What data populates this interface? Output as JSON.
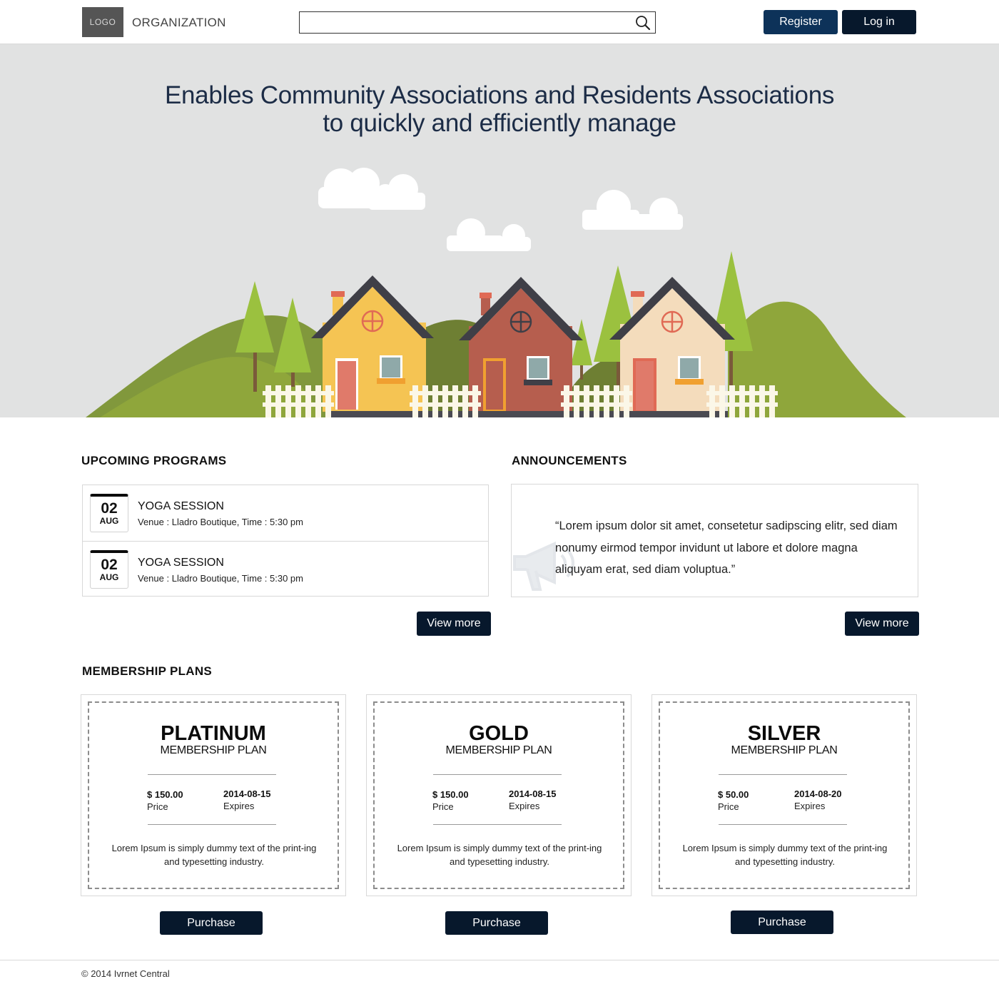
{
  "header": {
    "logo": "LOGO",
    "organization": "ORGANIZATION",
    "search_placeholder": "",
    "register": "Register",
    "login": "Log in"
  },
  "hero": {
    "line1": "Enables Community Associations and Residents Associations",
    "line2": "to quickly and efficiently manage",
    "colors": {
      "background": "#e1e2e2",
      "hill": "#8fa63b",
      "tree": "#9bc13f",
      "house_yellow": "#f5c453",
      "house_brown": "#b65e4e",
      "house_cream": "#f4dcbc"
    }
  },
  "programs": {
    "title": "UPCOMING PROGRAMS",
    "items": [
      {
        "day": "02",
        "month": "AUG",
        "name": "YOGA SESSION",
        "venue": "Venue : Lladro Boutique, Time : 5:30 pm"
      },
      {
        "day": "02",
        "month": "AUG",
        "name": "YOGA SESSION",
        "venue": "Venue : Lladro Boutique, Time : 5:30 pm"
      }
    ],
    "view_more": "View more"
  },
  "announcements": {
    "title": "ANNOUNCEMENTS",
    "text": "“Lorem ipsum dolor sit amet, consetetur sadipscing elitr, sed diam nonumy eirmod tempor invidunt ut labore et dolore magna aliquyam erat, sed diam voluptua.”",
    "icon": "megaphone-icon",
    "view_more": "View more"
  },
  "membership": {
    "title": "MEMBERSHIP PLANS",
    "plans": [
      {
        "name": "PLATINUM",
        "subtitle": "MEMBERSHIP PLAN",
        "price": "$ 150.00",
        "price_label": "Price",
        "expires": "2014-08-15",
        "expires_label": "Expires",
        "description": "Lorem Ipsum is simply dummy text of the print-ing and typesetting industry.",
        "button": "Purchase"
      },
      {
        "name": "GOLD",
        "subtitle": "MEMBERSHIP PLAN",
        "price": "$ 150.00",
        "price_label": "Price",
        "expires": "2014-08-15",
        "expires_label": "Expires",
        "description": "Lorem Ipsum is simply dummy text of the print-ing and typesetting industry.",
        "button": "Purchase"
      },
      {
        "name": "SILVER",
        "subtitle": "MEMBERSHIP PLAN",
        "price": "$ 50.00",
        "price_label": "Price",
        "expires": "2014-08-20",
        "expires_label": "Expires",
        "description": "Lorem Ipsum is simply dummy text of the print-ing and typesetting industry.",
        "button": "Purchase"
      }
    ]
  },
  "footer": {
    "copyright": "© 2014 Ivrnet Central"
  },
  "colors": {
    "primary": "#0d3259",
    "dark": "#07182c",
    "border": "#d8d8d8"
  }
}
